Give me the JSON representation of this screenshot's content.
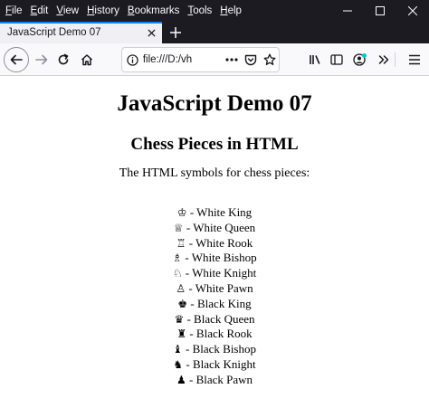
{
  "menu": [
    {
      "u": "F",
      "rest": "ile"
    },
    {
      "u": "E",
      "rest": "dit"
    },
    {
      "u": "V",
      "rest": "iew"
    },
    {
      "u": "H",
      "rest": "istory"
    },
    {
      "u": "B",
      "rest": "ookmarks"
    },
    {
      "u": "T",
      "rest": "ools"
    },
    {
      "u": "H",
      "rest": "elp"
    }
  ],
  "tab": {
    "title": "JavaScript Demo 07"
  },
  "url": {
    "text": "file:///D:/vh"
  },
  "page": {
    "heading": "JavaScript Demo 07",
    "subheading": "Chess Pieces in HTML",
    "intro": "The HTML symbols for chess pieces:",
    "pieces": [
      {
        "symbol": "♔",
        "label": " - White King"
      },
      {
        "symbol": "♕",
        "label": " - White Queen"
      },
      {
        "symbol": "♖",
        "label": " - White Rook"
      },
      {
        "symbol": "♗",
        "label": " - White Bishop"
      },
      {
        "symbol": "♘",
        "label": " - White Knight"
      },
      {
        "symbol": "♙",
        "label": " - White Pawn"
      },
      {
        "symbol": "♚",
        "label": " - Black King"
      },
      {
        "symbol": "♛",
        "label": " - Black Queen"
      },
      {
        "symbol": "♜",
        "label": " - Black Rook"
      },
      {
        "symbol": "♝",
        "label": " - Black Bishop"
      },
      {
        "symbol": "♞",
        "label": " - Black Knight"
      },
      {
        "symbol": "♟",
        "label": " - Black Pawn"
      }
    ]
  },
  "icons": {
    "minimize": "minimize-icon",
    "maximize": "maximize-icon",
    "close": "close-icon",
    "tab_close": "close-icon",
    "new_tab": "plus-icon",
    "back": "arrow-left-icon",
    "forward": "arrow-right-icon",
    "reload": "reload-icon",
    "home": "home-icon",
    "site_info": "info-icon",
    "page_actions": "ellipsis-icon",
    "pocket": "pocket-icon",
    "bookmark": "star-icon",
    "library": "library-icon",
    "sidebar": "sidebar-icon",
    "account": "account-icon",
    "overflow": "chevron-double-right-icon",
    "menu": "hamburger-icon"
  },
  "colors": {
    "titlebar": "#1c1b22",
    "tab_active": "#f0f0f4",
    "accent": "#0a84ff",
    "toolbar": "#f9f9fb"
  }
}
